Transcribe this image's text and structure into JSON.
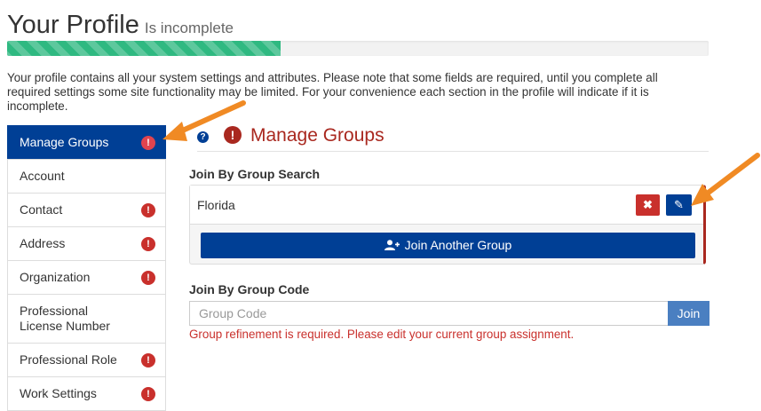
{
  "header": {
    "title": "Your Profile",
    "status": "Is incomplete"
  },
  "progress": {
    "percent": 39
  },
  "intro_text": "Your profile contains all your system settings and attributes. Please note that some fields are required, until you complete all required settings some site functionality may be limited. For your convenience each section in the profile will indicate if it is incomplete.",
  "sidebar": {
    "items": [
      {
        "label": "Manage Groups",
        "active": true,
        "incomplete": true
      },
      {
        "label": "Account",
        "active": false,
        "incomplete": false
      },
      {
        "label": "Contact",
        "active": false,
        "incomplete": true
      },
      {
        "label": "Address",
        "active": false,
        "incomplete": true
      },
      {
        "label": "Organization",
        "active": false,
        "incomplete": true
      },
      {
        "label": "Professional License Number",
        "active": false,
        "incomplete": false
      },
      {
        "label": "Professional Role",
        "active": false,
        "incomplete": true
      },
      {
        "label": "Work Settings",
        "active": false,
        "incomplete": true
      }
    ]
  },
  "section": {
    "title": "Manage Groups",
    "join_search_label": "Join By Group Search",
    "group_name": "Florida",
    "join_another_label": "Join Another Group",
    "join_code_label": "Join By Group Code",
    "code_placeholder": "Group Code",
    "join_button_label": "Join",
    "error_message": "Group refinement is required. Please edit your current group assignment."
  },
  "glyphs": {
    "alert": "!",
    "help": "?",
    "remove": "✖",
    "edit": "✎"
  },
  "colors": {
    "primary": "#003f95",
    "danger": "#c9302c",
    "section_title": "#a9281f",
    "progress": "#2fb981",
    "annotation_arrow": "#f08a24"
  }
}
